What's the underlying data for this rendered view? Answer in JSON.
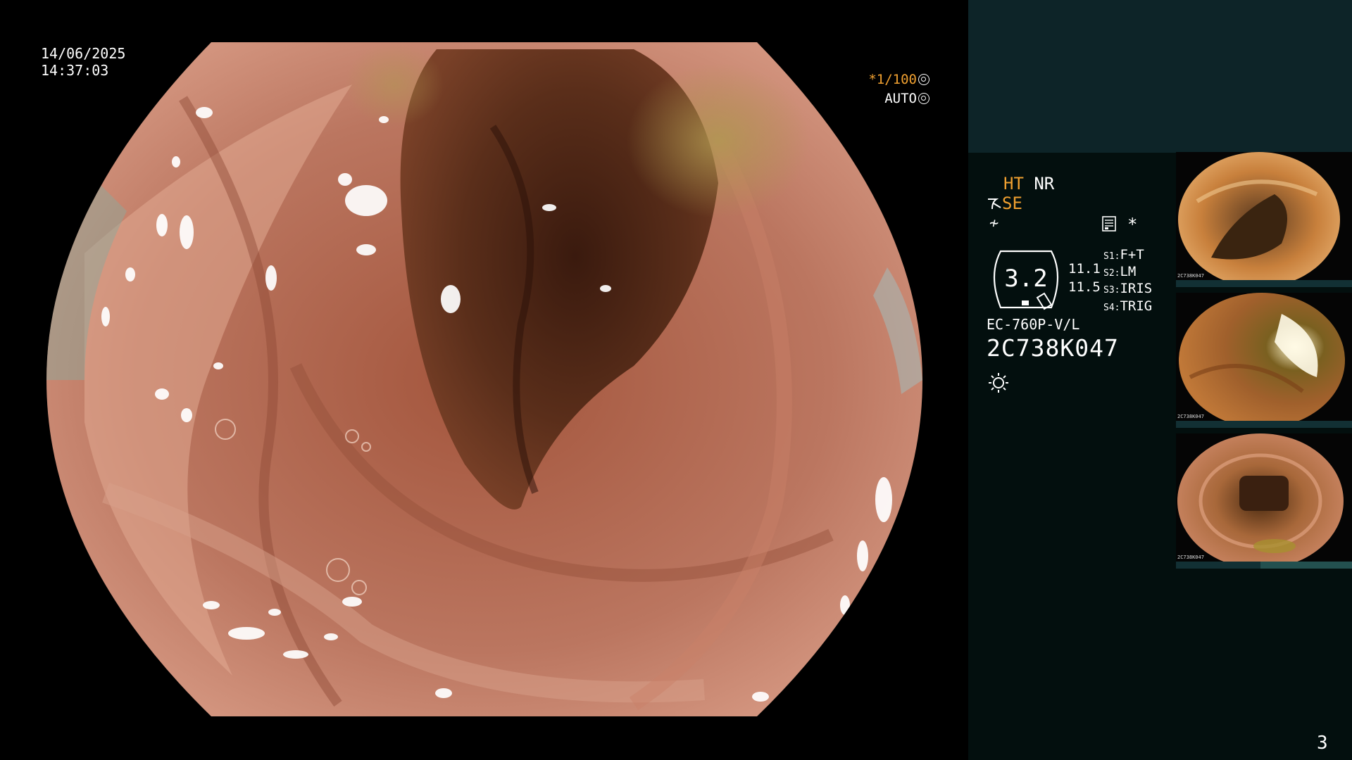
{
  "osd": {
    "date": "14/06/2025",
    "time": "14:37:03",
    "shutter_prefix": "*",
    "shutter": "1/100",
    "iris_mode": "AUTO"
  },
  "panel": {
    "ht": "HT",
    "nr": "NR",
    "se": "SE",
    "chroma_symbol": "≁",
    "star": "*",
    "zoom_value": "3.2",
    "value_a": "11.1",
    "value_b": "11.5",
    "switches": [
      {
        "key": "S1",
        "label": "F+T"
      },
      {
        "key": "S2",
        "label": "LM"
      },
      {
        "key": "S3",
        "label": "IRIS"
      },
      {
        "key": "S4",
        "label": "TRIG"
      }
    ],
    "scope_model": "EC-760P-V/L",
    "scope_serial": "2C738K047",
    "page_number": "3"
  },
  "thumbnails": [
    {
      "caption": "2C738K047"
    },
    {
      "caption": "2C738K047"
    },
    {
      "caption": "2C738K047"
    }
  ],
  "colors": {
    "accent_amber": "#f0a030",
    "panel_top": "#0d2428",
    "panel_bottom": "#030f0e",
    "mucosa": "#b5705a",
    "lumen": "#3a1a0e"
  }
}
